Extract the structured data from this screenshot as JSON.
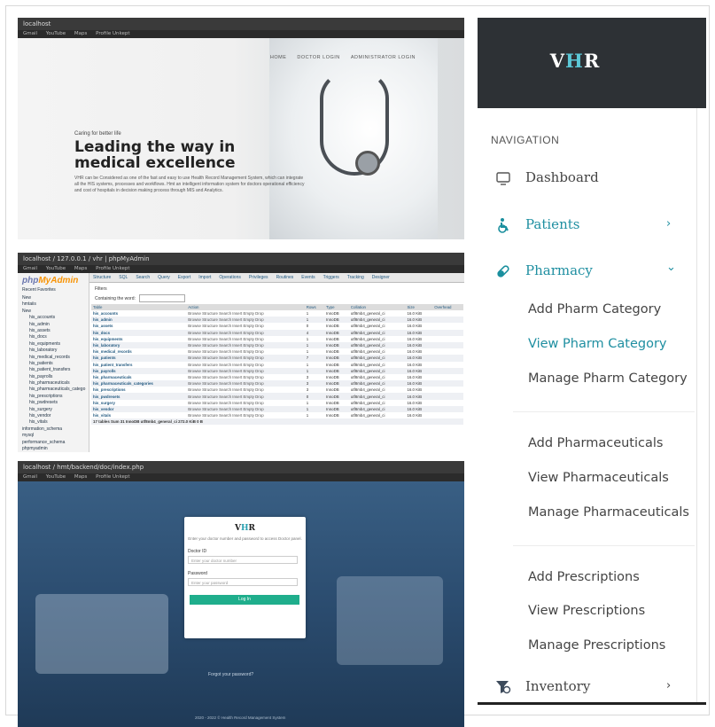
{
  "landing": {
    "chrome_title": "localhost",
    "bookmarks": [
      "Gmail",
      "YouTube",
      "Maps",
      "Profile Unkept"
    ],
    "nav_links": [
      "HOME",
      "DOCTOR LOGIN",
      "ADMINISTRATOR LOGIN"
    ],
    "tagline": "Caring for better life",
    "headline": "Leading the way in medical excellence",
    "paragraph": "VHR can be Considered as one of the fast and easy to use Health Record Management System, which can integrate all the HIS systems, processes and workflows. Hmt an intelligent information system for doctors operational efficiency and cost of hospitals in decision making process through MIS and Analytics."
  },
  "pma": {
    "chrome_title": "localhost / 127.0.0.1 / vhr | phpMyAdmin",
    "bookmarks": [
      "Gmail",
      "YouTube",
      "Maps",
      "Profile Unkept"
    ],
    "logo_a": "php",
    "logo_b": "MyAdmin",
    "side_tabs": "Recent  Favorites",
    "tree": [
      "New",
      "hmtaiis",
      "New",
      "his_accounts",
      "his_admin",
      "his_assets",
      "his_docs",
      "his_equipments",
      "his_laboratory",
      "his_medical_records",
      "his_patients",
      "his_patient_transfers",
      "his_payrolls",
      "his_pharmaceuticals",
      "his_pharmaceuticals_catego",
      "his_prescriptions",
      "his_pwdresets",
      "his_surgery",
      "his_vendor",
      "his_vitals",
      "information_schema",
      "mysql",
      "performance_schema",
      "phpmyadmin",
      "test"
    ],
    "tabs": [
      "Structure",
      "SQL",
      "Search",
      "Query",
      "Export",
      "Import",
      "Operations",
      "Privileges",
      "Routines",
      "Events",
      "Triggers",
      "Tracking",
      "Designer"
    ],
    "filters_label": "Filters",
    "filter_text": "Containing the word:",
    "columns": [
      "Table",
      "Action",
      "Rows",
      "Type",
      "Collation",
      "Size",
      "Overhead"
    ],
    "actions": "Browse  Structure  Search  Insert  Empty  Drop",
    "rows": [
      {
        "table": "his_accounts",
        "rows": "1",
        "type": "InnoDB",
        "collation": "utf8mb4_general_ci",
        "size": "16.0 KiB"
      },
      {
        "table": "his_admin",
        "rows": "1",
        "type": "InnoDB",
        "collation": "utf8mb4_general_ci",
        "size": "16.0 KiB"
      },
      {
        "table": "his_assets",
        "rows": "0",
        "type": "InnoDB",
        "collation": "utf8mb4_general_ci",
        "size": "16.0 KiB"
      },
      {
        "table": "his_docs",
        "rows": "4",
        "type": "InnoDB",
        "collation": "utf8mb4_general_ci",
        "size": "16.0 KiB"
      },
      {
        "table": "his_equipments",
        "rows": "1",
        "type": "InnoDB",
        "collation": "utf8mb4_general_ci",
        "size": "16.0 KiB"
      },
      {
        "table": "his_laboratory",
        "rows": "1",
        "type": "InnoDB",
        "collation": "utf8mb4_general_ci",
        "size": "16.0 KiB"
      },
      {
        "table": "his_medical_records",
        "rows": "1",
        "type": "InnoDB",
        "collation": "utf8mb4_general_ci",
        "size": "16.0 KiB"
      },
      {
        "table": "his_patients",
        "rows": "7",
        "type": "InnoDB",
        "collation": "utf8mb4_general_ci",
        "size": "16.0 KiB"
      },
      {
        "table": "his_patient_transfers",
        "rows": "1",
        "type": "InnoDB",
        "collation": "utf8mb4_general_ci",
        "size": "16.0 KiB"
      },
      {
        "table": "his_payrolls",
        "rows": "1",
        "type": "InnoDB",
        "collation": "utf8mb4_general_ci",
        "size": "16.0 KiB"
      },
      {
        "table": "his_pharmaceuticals",
        "rows": "3",
        "type": "InnoDB",
        "collation": "utf8mb4_general_ci",
        "size": "16.0 KiB"
      },
      {
        "table": "his_pharmaceuticals_categories",
        "rows": "3",
        "type": "InnoDB",
        "collation": "utf8mb4_general_ci",
        "size": "16.0 KiB"
      },
      {
        "table": "his_prescriptions",
        "rows": "3",
        "type": "InnoDB",
        "collation": "utf8mb4_general_ci",
        "size": "16.0 KiB"
      },
      {
        "table": "his_pwdresets",
        "rows": "0",
        "type": "InnoDB",
        "collation": "utf8mb4_general_ci",
        "size": "16.0 KiB"
      },
      {
        "table": "his_surgery",
        "rows": "1",
        "type": "InnoDB",
        "collation": "utf8mb4_general_ci",
        "size": "16.0 KiB"
      },
      {
        "table": "his_vendor",
        "rows": "1",
        "type": "InnoDB",
        "collation": "utf8mb4_general_ci",
        "size": "16.0 KiB"
      },
      {
        "table": "his_vitals",
        "rows": "1",
        "type": "InnoDB",
        "collation": "utf8mb4_general_ci",
        "size": "16.0 KiB"
      }
    ],
    "footer": "17 tables  Sum  31  InnoDB  utf8mb4_general_ci  272.0 KiB  0 B"
  },
  "login": {
    "chrome_title": "localhost / hmt/backend/doc/index.php",
    "bookmarks": [
      "Gmail",
      "YouTube",
      "Maps",
      "Profile Unkept"
    ],
    "logo_a": "V",
    "logo_b": "H",
    "logo_c": "R",
    "subtitle": "Enter your doctor number and password to access Doctor panel.",
    "doc_label": "Doctor ID",
    "doc_placeholder": "Enter your doctor number",
    "pwd_label": "Password",
    "pwd_placeholder": "Enter your password",
    "button": "Log In",
    "forgot": "Forgot your password?",
    "copyright": "2020 - 2022 © Health Record Management System"
  },
  "sidebar": {
    "logo_a": "V",
    "logo_b": "H",
    "logo_c": "R",
    "nav_heading": "NAVIGATION",
    "dashboard": "Dashboard",
    "patients": "Patients",
    "pharmacy": "Pharmacy",
    "inventory": "Inventory",
    "chevron_right": "›",
    "chevron_down": "⌄",
    "pharm_cat": [
      "Add Pharm Category",
      "View Pharm Category",
      "Manage Pharm Category"
    ],
    "pharmaceuticals": [
      "Add Pharmaceuticals",
      "View Pharmaceuticals",
      "Manage Pharmaceuticals"
    ],
    "prescriptions": [
      "Add Prescriptions",
      "View Prescriptions",
      "Manage Prescriptions"
    ],
    "active_item": "View Pharm Category",
    "colors": {
      "header": "#2d3135",
      "accent": "#1f8fa1",
      "icon_teal": "#1a8f9e",
      "inventory_icon": "#3d4b5c"
    }
  }
}
